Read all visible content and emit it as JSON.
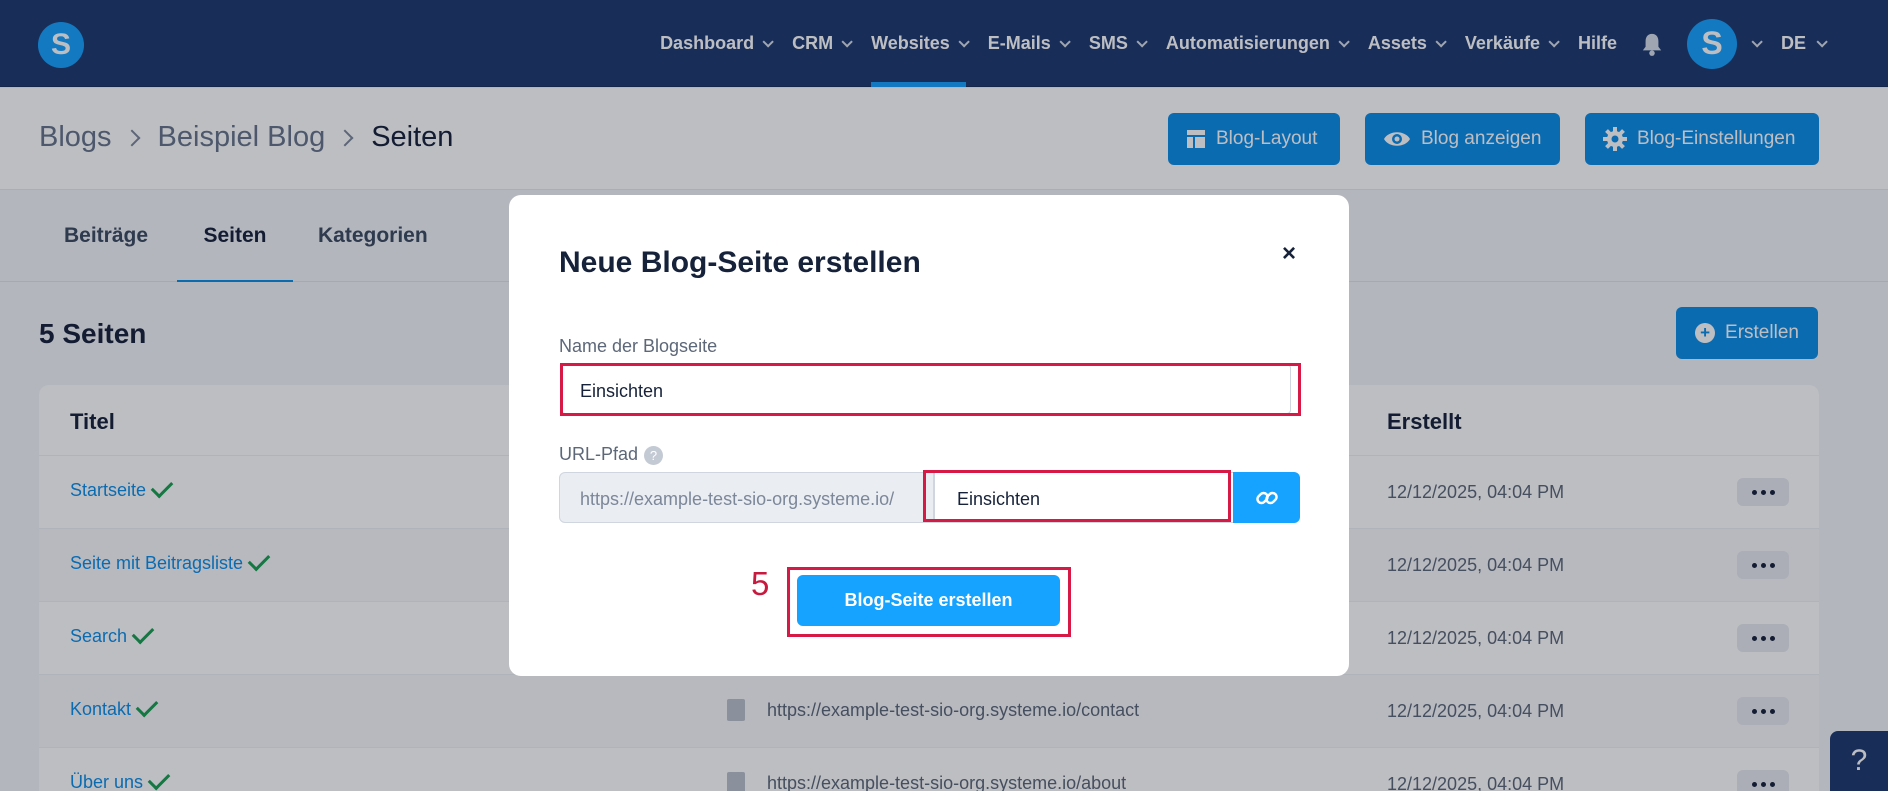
{
  "nav": {
    "items": [
      {
        "label": "Dashboard",
        "dropdown": true,
        "active": false
      },
      {
        "label": "CRM",
        "dropdown": true,
        "active": false
      },
      {
        "label": "Websites",
        "dropdown": true,
        "active": true
      },
      {
        "label": "E-Mails",
        "dropdown": true,
        "active": false
      },
      {
        "label": "SMS",
        "dropdown": true,
        "active": false
      },
      {
        "label": "Automatisierungen",
        "dropdown": true,
        "active": false
      },
      {
        "label": "Assets",
        "dropdown": true,
        "active": false
      },
      {
        "label": "Verkäufe",
        "dropdown": true,
        "active": false
      },
      {
        "label": "Hilfe",
        "dropdown": false,
        "active": false
      }
    ],
    "logo_letter": "S",
    "avatar_letter": "S",
    "language": "DE"
  },
  "breadcrumb": [
    "Blogs",
    "Beispiel Blog",
    "Seiten"
  ],
  "header_buttons": {
    "layout": "Blog-Layout",
    "view": "Blog anzeigen",
    "settings": "Blog-Einstellungen"
  },
  "tabs": [
    "Beiträge",
    "Seiten",
    "Kategorien"
  ],
  "content": {
    "count_title": "5 Seiten",
    "create_label": "Erstellen",
    "columns": {
      "title": "Titel",
      "created": "Erstellt"
    },
    "rows": [
      {
        "title": "Startseite",
        "url": "",
        "date": "12/12/2025, 04:04 PM"
      },
      {
        "title": "Seite mit Beitragsliste",
        "url": "",
        "date": "12/12/2025, 04:04 PM"
      },
      {
        "title": "Search",
        "url": "",
        "date": "12/12/2025, 04:04 PM"
      },
      {
        "title": "Kontakt",
        "url": "https://example-test-sio-org.systeme.io/contact",
        "date": "12/12/2025, 04:04 PM"
      },
      {
        "title": "Über uns",
        "url": "https://example-test-sio-org.systeme.io/about",
        "date": "12/12/2025, 04:04 PM"
      }
    ]
  },
  "modal": {
    "title": "Neue Blog-Seite erstellen",
    "close_glyph": "×",
    "name_label": "Name der Blogseite",
    "name_value": "Einsichten",
    "url_label": "URL-Pfad",
    "url_help": "?",
    "url_prefix": "https://example-test-sio-org.systeme.io/",
    "url_value": "Einsichten",
    "submit_label": "Blog-Seite erstellen"
  },
  "annotation": {
    "step": "5",
    "color": "#d61a45"
  },
  "help_glyph": "?",
  "colors": {
    "nav_bg": "#1e3a6e",
    "accent": "#16a2ff",
    "button": "#0c8ee8",
    "check": "#1a9e50"
  }
}
